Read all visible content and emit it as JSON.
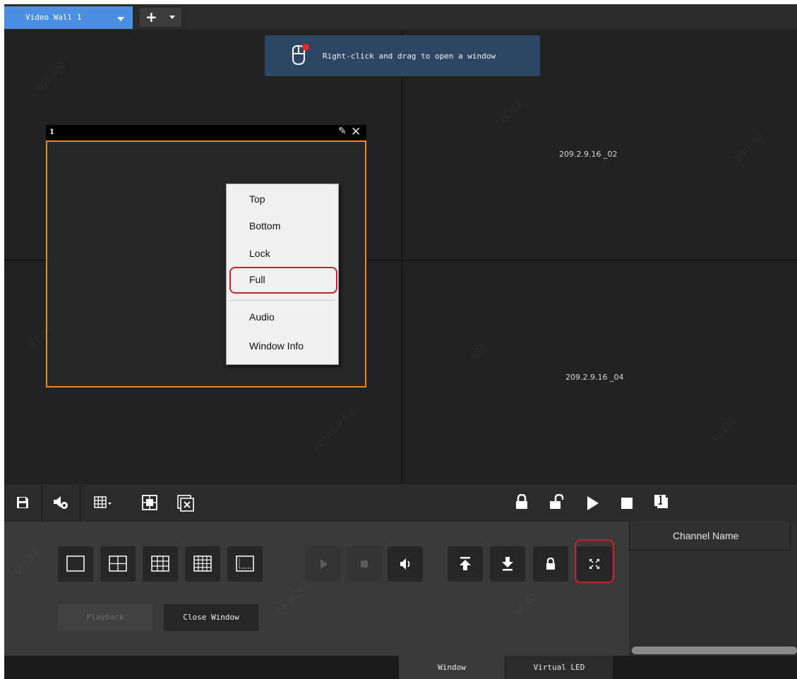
{
  "tabs": {
    "active_label": "Video Wall 1"
  },
  "wall": {
    "hint_text": "Right-click and drag to open a window",
    "screens": [
      {
        "label": "209.2.9.16 _02"
      },
      {
        "label": "209.2.9.16 _04"
      }
    ],
    "window": {
      "number": "1"
    },
    "context_menu": {
      "items": [
        "Top",
        "Bottom",
        "Lock",
        "Full",
        "Audio",
        "Window Info"
      ],
      "highlighted": "Full"
    }
  },
  "panel": {
    "playback_label": "Playback",
    "close_window_label": "Close Window"
  },
  "channel": {
    "header": "Channel Name"
  },
  "bottom_tabs": [
    "Window",
    "Virtual LED"
  ],
  "colors": {
    "accent": "#4a8fe0",
    "window_border": "#e88b1b",
    "highlight": "#c8232c"
  }
}
